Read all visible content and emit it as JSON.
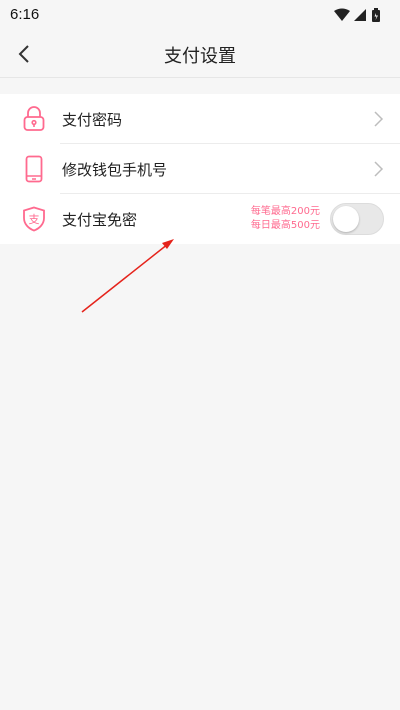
{
  "status_bar": {
    "time": "6:16",
    "icons": [
      "wifi-icon",
      "signal-icon",
      "battery-icon"
    ]
  },
  "header": {
    "title": "支付设置",
    "back_icon": "chevron-left-icon"
  },
  "settings": {
    "items": [
      {
        "label": "支付密码",
        "icon": "lock-icon",
        "trailing": "chevron-right-icon"
      },
      {
        "label": "修改钱包手机号",
        "icon": "phone-icon",
        "trailing": "chevron-right-icon"
      },
      {
        "label": "支付宝免密",
        "icon": "alipay-shield-icon",
        "icon_char": "支",
        "limit_per_transaction": "每笔最高200元",
        "limit_per_day": "每日最高500元",
        "toggle_on": false
      }
    ]
  },
  "colors": {
    "accent_pink": "#ff6a8f",
    "annotation_red": "#e5231b",
    "background": "#f6f6f6"
  }
}
